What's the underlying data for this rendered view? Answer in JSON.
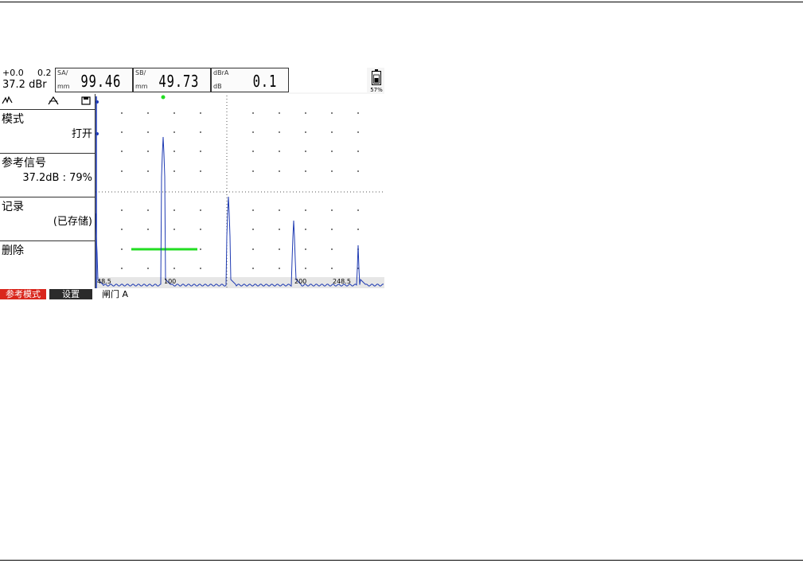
{
  "header": {
    "gain_delta": "+0.0",
    "gain_step": "0.2",
    "gain_main": "37.2 dBr",
    "sa": {
      "label_top": "SA/",
      "label_bottom": "mm",
      "value": "99.46"
    },
    "sb": {
      "label_top": "SB/",
      "label_bottom": "mm",
      "value": "49.73"
    },
    "dbr": {
      "label_top": "dBrA",
      "label_bottom": "dB",
      "value": "0.1"
    },
    "battery_percent": "57%"
  },
  "mode_icons": [
    "rf-signal-icon",
    "envelope-icon",
    "save-icon"
  ],
  "menu": {
    "mode": {
      "label": "模式",
      "value": "打开"
    },
    "reference": {
      "label": "参考信号",
      "value": "37.2dB : 79%"
    },
    "record": {
      "label": "记录",
      "value": "(已存储)"
    },
    "delete": {
      "label": "删除"
    }
  },
  "ascan": {
    "axis_ticks": [
      "48.5",
      "100",
      "200",
      "248.5"
    ],
    "colors": {
      "signal": "#1f3bb3",
      "gate": "#22dd22",
      "grid": "#555555"
    }
  },
  "tabs": {
    "reference_mode": "参考模式",
    "settings": "设置",
    "gate": "闸门 A"
  }
}
